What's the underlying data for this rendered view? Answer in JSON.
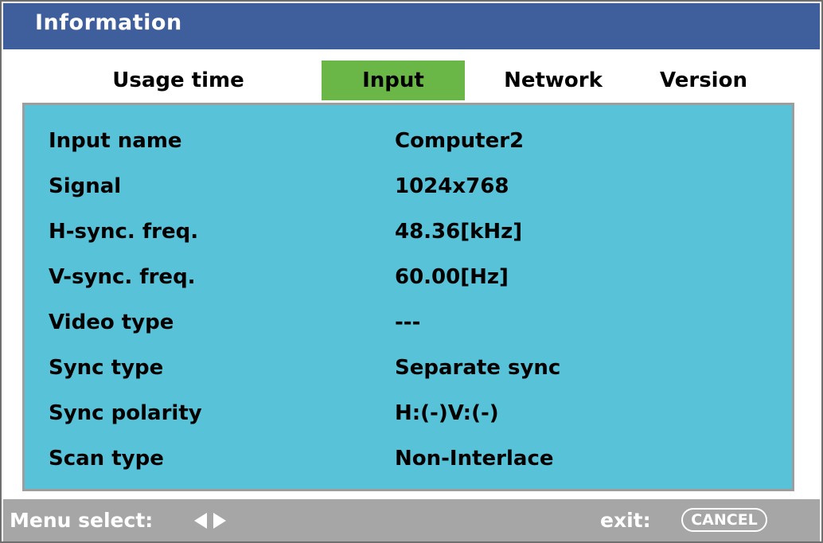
{
  "window": {
    "title": "Information"
  },
  "tabs": [
    {
      "label": "Usage time",
      "active": false
    },
    {
      "label": "Input",
      "active": true
    },
    {
      "label": "Network",
      "active": false
    },
    {
      "label": "Version",
      "active": false
    }
  ],
  "rows": [
    {
      "label": "Input name",
      "value": "Computer2"
    },
    {
      "label": "Signal",
      "value": "1024x768"
    },
    {
      "label": "H-sync. freq.",
      "value": "48.36[kHz]"
    },
    {
      "label": "V-sync. freq.",
      "value": "60.00[Hz]"
    },
    {
      "label": "Video type",
      "value": "---"
    },
    {
      "label": "Sync type",
      "value": "Separate sync"
    },
    {
      "label": "Sync polarity",
      "value": "H:(-)V:(-)"
    },
    {
      "label": "Scan type",
      "value": "Non-Interlace"
    }
  ],
  "footer": {
    "menu_select_label": "Menu select:",
    "nav_icon": "left-right-arrows-icon",
    "exit_label": "exit:",
    "cancel_label": "CANCEL"
  },
  "colors": {
    "title_bar": "#3f5e9c",
    "active_tab": "#6ab646",
    "panel": "#57c2d8",
    "footer": "#a6a6a6"
  }
}
